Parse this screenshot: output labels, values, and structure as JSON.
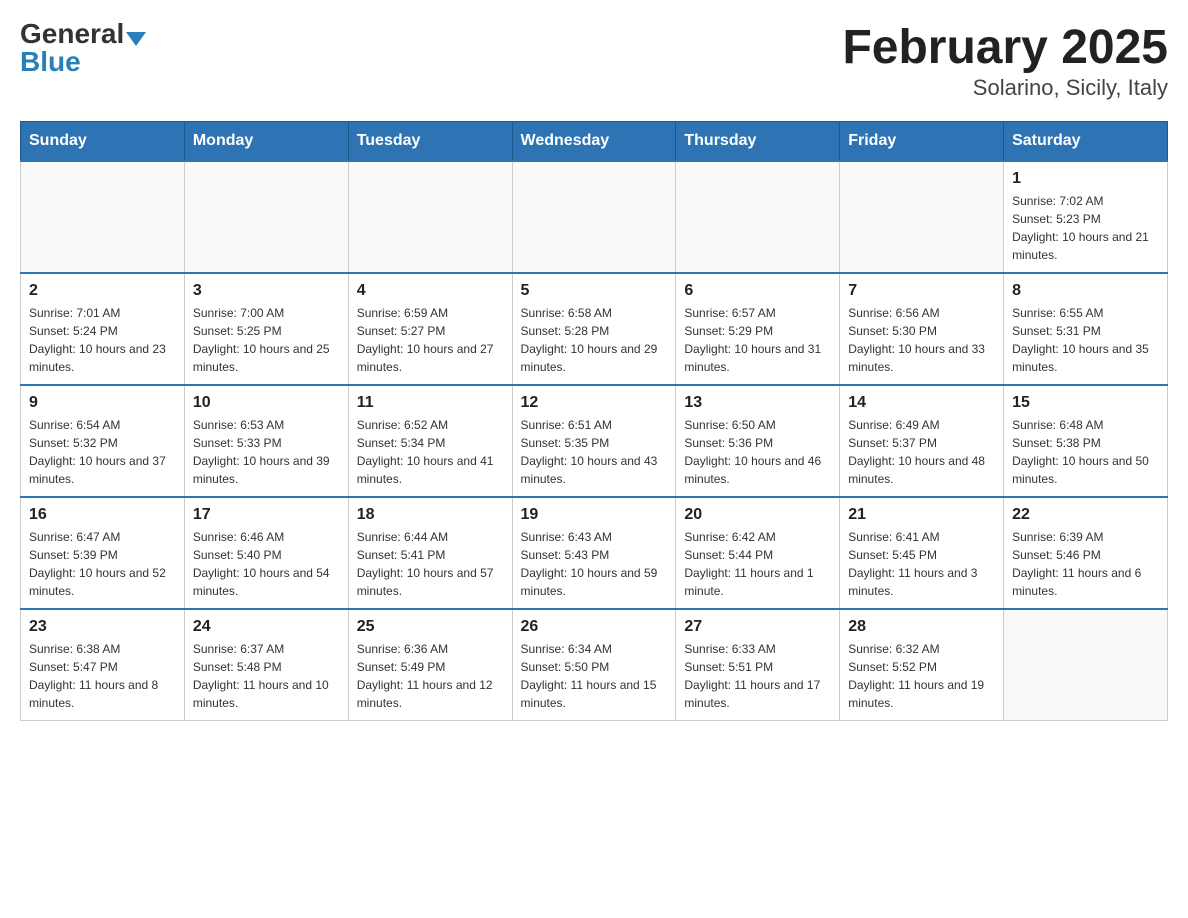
{
  "logo": {
    "general": "General",
    "blue": "Blue",
    "triangle": "▲"
  },
  "title": "February 2025",
  "subtitle": "Solarino, Sicily, Italy",
  "weekdays": [
    "Sunday",
    "Monday",
    "Tuesday",
    "Wednesday",
    "Thursday",
    "Friday",
    "Saturday"
  ],
  "weeks": [
    [
      {
        "day": "",
        "info": ""
      },
      {
        "day": "",
        "info": ""
      },
      {
        "day": "",
        "info": ""
      },
      {
        "day": "",
        "info": ""
      },
      {
        "day": "",
        "info": ""
      },
      {
        "day": "",
        "info": ""
      },
      {
        "day": "1",
        "info": "Sunrise: 7:02 AM\nSunset: 5:23 PM\nDaylight: 10 hours and 21 minutes."
      }
    ],
    [
      {
        "day": "2",
        "info": "Sunrise: 7:01 AM\nSunset: 5:24 PM\nDaylight: 10 hours and 23 minutes."
      },
      {
        "day": "3",
        "info": "Sunrise: 7:00 AM\nSunset: 5:25 PM\nDaylight: 10 hours and 25 minutes."
      },
      {
        "day": "4",
        "info": "Sunrise: 6:59 AM\nSunset: 5:27 PM\nDaylight: 10 hours and 27 minutes."
      },
      {
        "day": "5",
        "info": "Sunrise: 6:58 AM\nSunset: 5:28 PM\nDaylight: 10 hours and 29 minutes."
      },
      {
        "day": "6",
        "info": "Sunrise: 6:57 AM\nSunset: 5:29 PM\nDaylight: 10 hours and 31 minutes."
      },
      {
        "day": "7",
        "info": "Sunrise: 6:56 AM\nSunset: 5:30 PM\nDaylight: 10 hours and 33 minutes."
      },
      {
        "day": "8",
        "info": "Sunrise: 6:55 AM\nSunset: 5:31 PM\nDaylight: 10 hours and 35 minutes."
      }
    ],
    [
      {
        "day": "9",
        "info": "Sunrise: 6:54 AM\nSunset: 5:32 PM\nDaylight: 10 hours and 37 minutes."
      },
      {
        "day": "10",
        "info": "Sunrise: 6:53 AM\nSunset: 5:33 PM\nDaylight: 10 hours and 39 minutes."
      },
      {
        "day": "11",
        "info": "Sunrise: 6:52 AM\nSunset: 5:34 PM\nDaylight: 10 hours and 41 minutes."
      },
      {
        "day": "12",
        "info": "Sunrise: 6:51 AM\nSunset: 5:35 PM\nDaylight: 10 hours and 43 minutes."
      },
      {
        "day": "13",
        "info": "Sunrise: 6:50 AM\nSunset: 5:36 PM\nDaylight: 10 hours and 46 minutes."
      },
      {
        "day": "14",
        "info": "Sunrise: 6:49 AM\nSunset: 5:37 PM\nDaylight: 10 hours and 48 minutes."
      },
      {
        "day": "15",
        "info": "Sunrise: 6:48 AM\nSunset: 5:38 PM\nDaylight: 10 hours and 50 minutes."
      }
    ],
    [
      {
        "day": "16",
        "info": "Sunrise: 6:47 AM\nSunset: 5:39 PM\nDaylight: 10 hours and 52 minutes."
      },
      {
        "day": "17",
        "info": "Sunrise: 6:46 AM\nSunset: 5:40 PM\nDaylight: 10 hours and 54 minutes."
      },
      {
        "day": "18",
        "info": "Sunrise: 6:44 AM\nSunset: 5:41 PM\nDaylight: 10 hours and 57 minutes."
      },
      {
        "day": "19",
        "info": "Sunrise: 6:43 AM\nSunset: 5:43 PM\nDaylight: 10 hours and 59 minutes."
      },
      {
        "day": "20",
        "info": "Sunrise: 6:42 AM\nSunset: 5:44 PM\nDaylight: 11 hours and 1 minute."
      },
      {
        "day": "21",
        "info": "Sunrise: 6:41 AM\nSunset: 5:45 PM\nDaylight: 11 hours and 3 minutes."
      },
      {
        "day": "22",
        "info": "Sunrise: 6:39 AM\nSunset: 5:46 PM\nDaylight: 11 hours and 6 minutes."
      }
    ],
    [
      {
        "day": "23",
        "info": "Sunrise: 6:38 AM\nSunset: 5:47 PM\nDaylight: 11 hours and 8 minutes."
      },
      {
        "day": "24",
        "info": "Sunrise: 6:37 AM\nSunset: 5:48 PM\nDaylight: 11 hours and 10 minutes."
      },
      {
        "day": "25",
        "info": "Sunrise: 6:36 AM\nSunset: 5:49 PM\nDaylight: 11 hours and 12 minutes."
      },
      {
        "day": "26",
        "info": "Sunrise: 6:34 AM\nSunset: 5:50 PM\nDaylight: 11 hours and 15 minutes."
      },
      {
        "day": "27",
        "info": "Sunrise: 6:33 AM\nSunset: 5:51 PM\nDaylight: 11 hours and 17 minutes."
      },
      {
        "day": "28",
        "info": "Sunrise: 6:32 AM\nSunset: 5:52 PM\nDaylight: 11 hours and 19 minutes."
      },
      {
        "day": "",
        "info": ""
      }
    ]
  ]
}
